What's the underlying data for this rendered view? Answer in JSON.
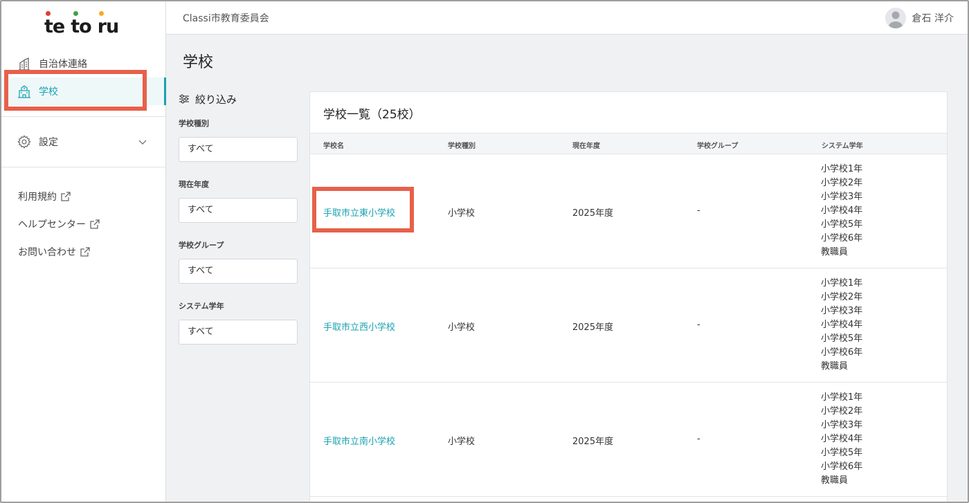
{
  "brand": {
    "logo_text_1": "te",
    "logo_text_2": "to",
    "logo_text_3": "ru",
    "dot_colors": [
      "#e53935",
      "#43a047",
      "#f9a825"
    ]
  },
  "header": {
    "org_name": "Classi市教育委員会",
    "user_name": "倉石 洋介"
  },
  "sidebar": {
    "items": [
      {
        "label": "自治体連絡",
        "icon": "building-icon",
        "active": false
      },
      {
        "label": "学校",
        "icon": "school-icon",
        "active": true
      }
    ],
    "settings_label": "設定",
    "links": [
      {
        "label": "利用規約",
        "icon": "external-link-icon"
      },
      {
        "label": "ヘルプセンター",
        "icon": "external-link-icon"
      },
      {
        "label": "お問い合わせ",
        "icon": "external-link-icon"
      }
    ]
  },
  "page": {
    "title": "学校"
  },
  "filter": {
    "title": "絞り込み",
    "groups": [
      {
        "label": "学校種別",
        "value": "すべて"
      },
      {
        "label": "現在年度",
        "value": "すべて"
      },
      {
        "label": "学校グループ",
        "value": "すべて"
      },
      {
        "label": "システム学年",
        "value": "すべて"
      }
    ]
  },
  "list": {
    "title": "学校一覧（25校）",
    "columns": [
      "学校名",
      "学校種別",
      "現在年度",
      "学校グループ",
      "システム学年"
    ],
    "rows": [
      {
        "name": "手取市立東小学校",
        "type": "小学校",
        "year": "2025年度",
        "group": "-",
        "grades": [
          "小学校1年",
          "小学校2年",
          "小学校3年",
          "小学校4年",
          "小学校5年",
          "小学校6年",
          "教職員"
        ]
      },
      {
        "name": "手取市立西小学校",
        "type": "小学校",
        "year": "2025年度",
        "group": "-",
        "grades": [
          "小学校1年",
          "小学校2年",
          "小学校3年",
          "小学校4年",
          "小学校5年",
          "小学校6年",
          "教職員"
        ]
      },
      {
        "name": "手取市立南小学校",
        "type": "小学校",
        "year": "2025年度",
        "group": "-",
        "grades": [
          "小学校1年",
          "小学校2年",
          "小学校3年",
          "小学校4年",
          "小学校5年",
          "小学校6年",
          "教職員"
        ]
      }
    ]
  },
  "colors": {
    "accent": "#19a1b1",
    "highlight": "#e8604a"
  }
}
